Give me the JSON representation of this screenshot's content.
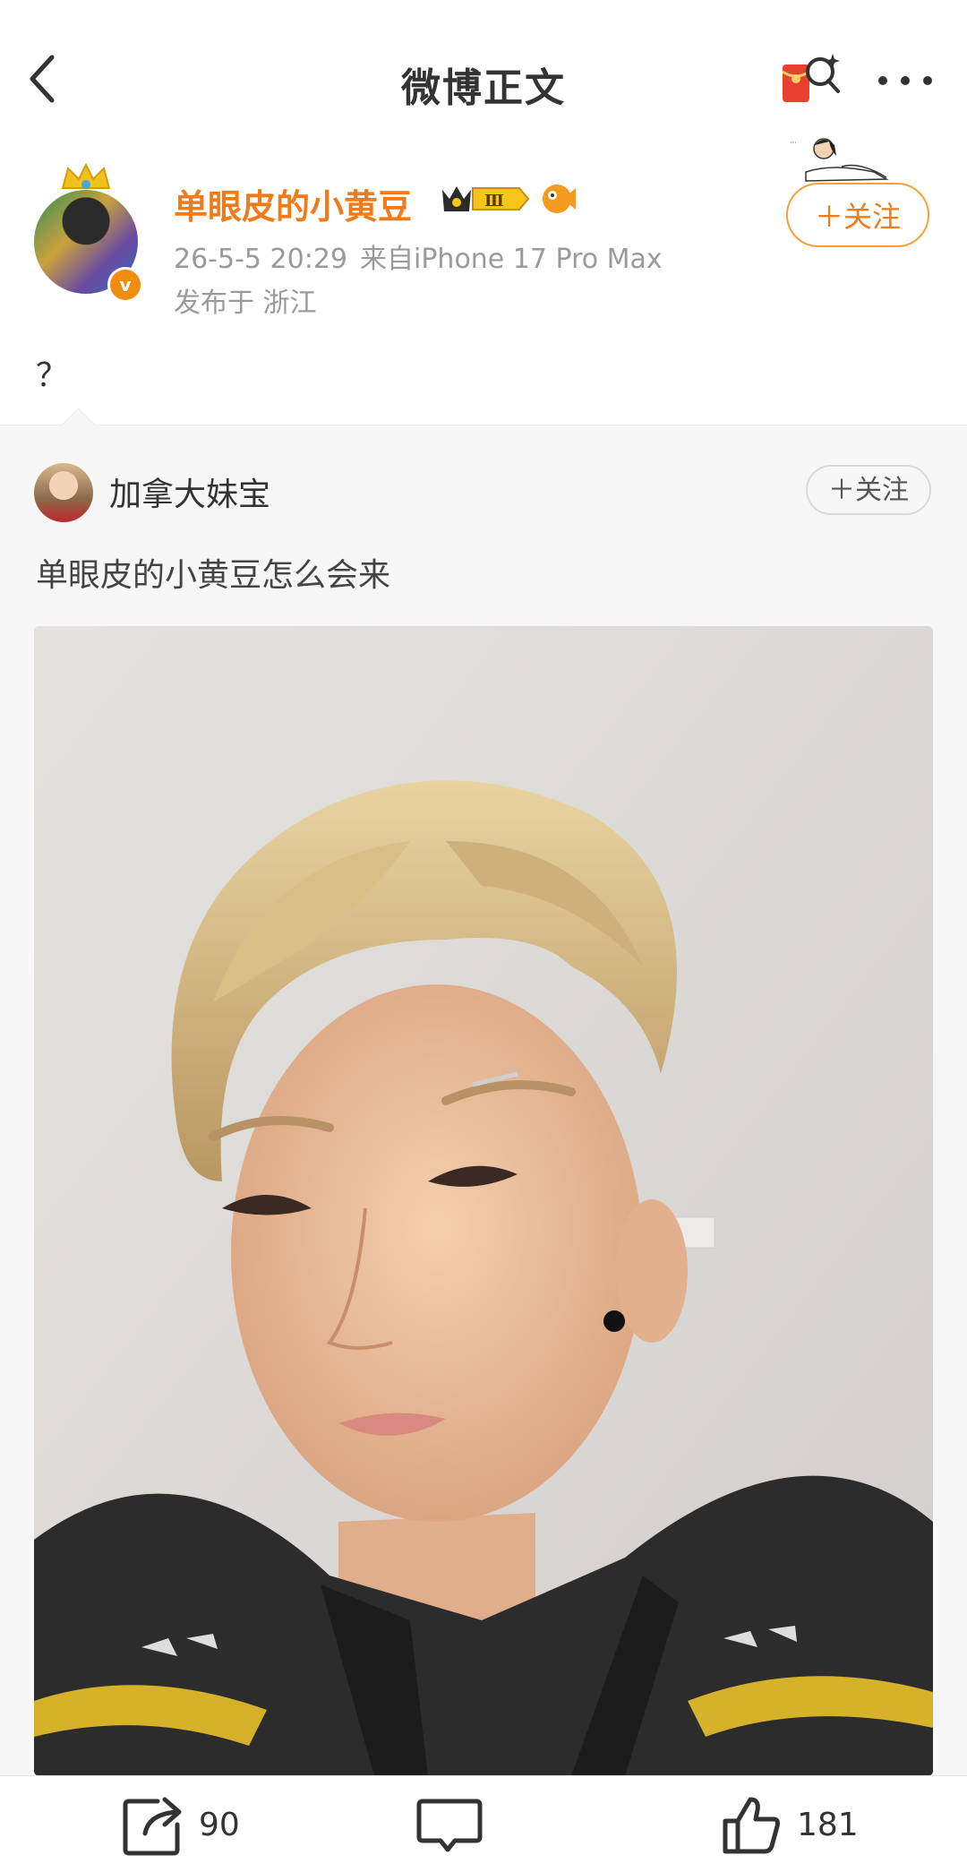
{
  "header": {
    "title": "微博正文",
    "back_icon": "chevron-left-icon",
    "redpack_icon": "red-packet-icon",
    "more_icon": "more-dots-icon"
  },
  "post": {
    "username": "单眼皮的小黄豆",
    "vip_level": "Ⅲ",
    "verified_mark": "v",
    "date": "26-5-5 20:29",
    "source": "来自iPhone 17 Pro Max",
    "location": "发布于 浙江",
    "follow_label": "＋关注",
    "text": "？"
  },
  "repost": {
    "username": "加拿大妹宝",
    "follow_label": "＋关注",
    "text": "单眼皮的小黄豆怎么会来"
  },
  "actions": {
    "repost_count": "90",
    "comment_count": "",
    "like_count": "181"
  },
  "colors": {
    "accent_orange": "#ef7b1a",
    "muted_gray": "#9a9a9a",
    "repost_bg": "#f7f7f7"
  }
}
